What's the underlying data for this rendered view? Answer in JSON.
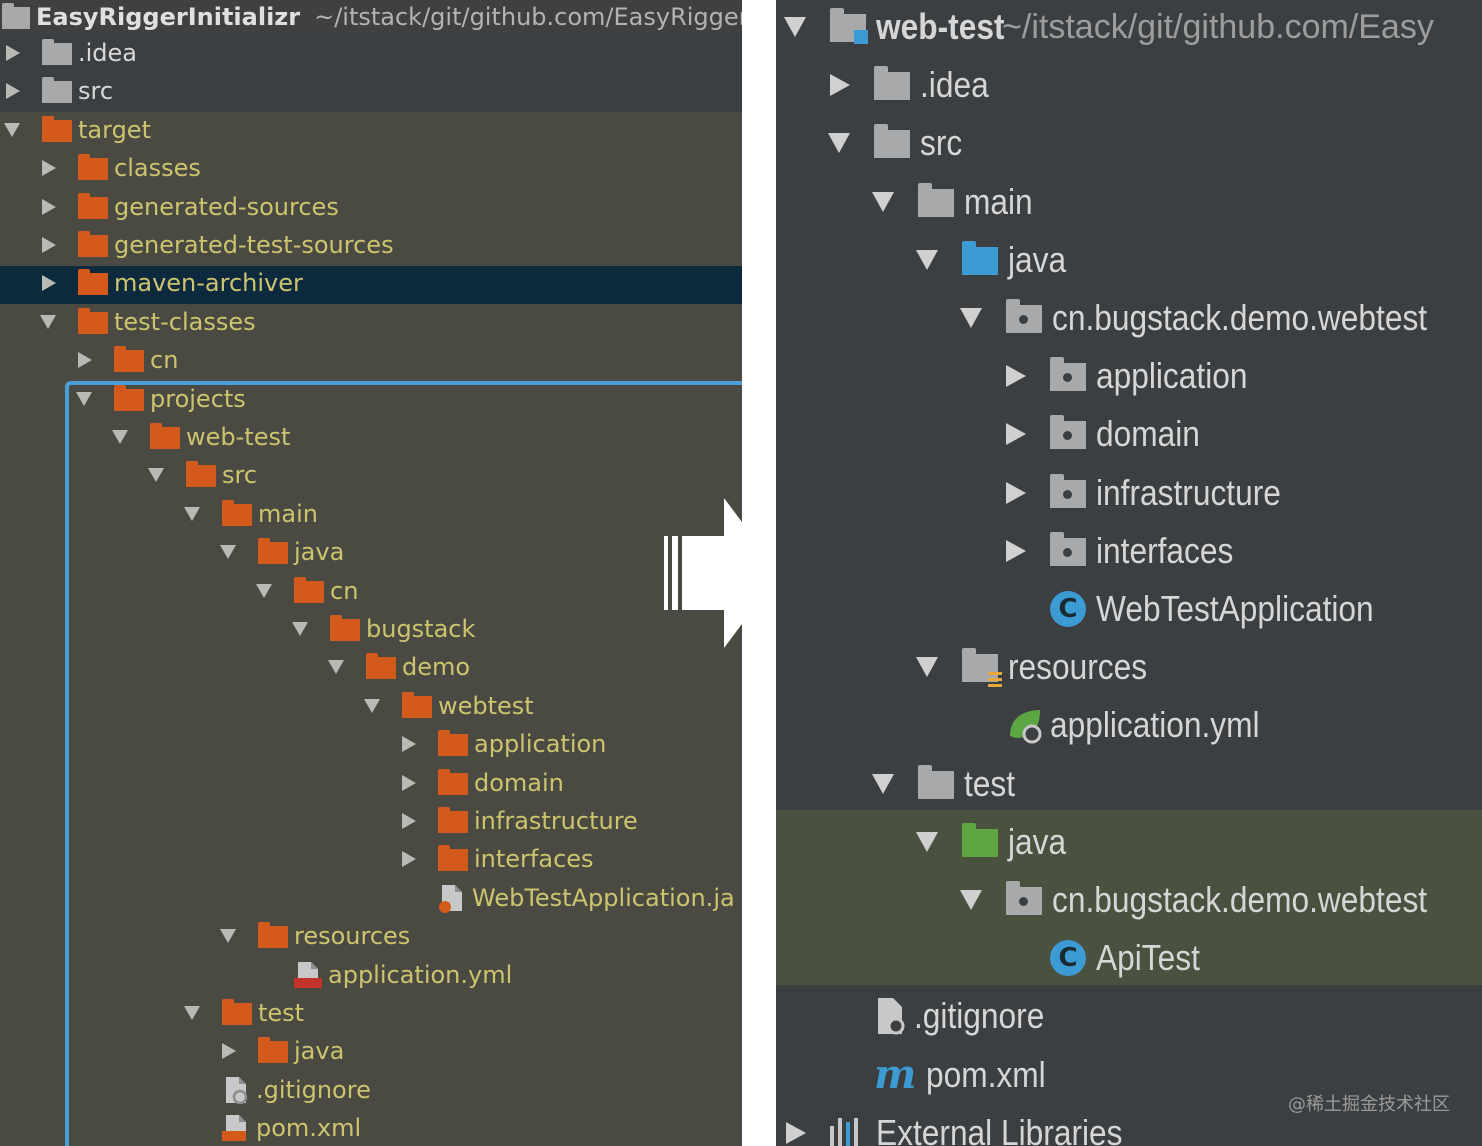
{
  "left_tree": {
    "root": {
      "name": "EasyRiggerInitializr",
      "path": "~/itstack/git/github.com/EasyRigger"
    },
    "items": [
      {
        "label": "EasyRiggerInitializr",
        "state": "root"
      },
      {
        "label": ".idea",
        "state": "collapsed",
        "depth": 0,
        "icon": "grey-folder"
      },
      {
        "label": "src",
        "state": "collapsed",
        "depth": 0,
        "icon": "grey-folder"
      },
      {
        "label": "target",
        "state": "expanded",
        "depth": 0,
        "icon": "orange-folder"
      },
      {
        "label": "classes",
        "state": "collapsed",
        "depth": 1,
        "icon": "orange-folder"
      },
      {
        "label": "generated-sources",
        "state": "collapsed",
        "depth": 1,
        "icon": "orange-folder"
      },
      {
        "label": "generated-test-sources",
        "state": "collapsed",
        "depth": 1,
        "icon": "orange-folder"
      },
      {
        "label": "maven-archiver",
        "state": "collapsed",
        "depth": 1,
        "icon": "orange-folder",
        "selected": true
      },
      {
        "label": "test-classes",
        "state": "expanded",
        "depth": 1,
        "icon": "orange-folder"
      },
      {
        "label": "cn",
        "state": "collapsed",
        "depth": 2,
        "icon": "orange-folder"
      },
      {
        "label": "projects",
        "state": "expanded",
        "depth": 2,
        "icon": "orange-folder"
      },
      {
        "label": "web-test",
        "state": "expanded",
        "depth": 3,
        "icon": "orange-folder"
      },
      {
        "label": "src",
        "state": "expanded",
        "depth": 4,
        "icon": "orange-folder"
      },
      {
        "label": "main",
        "state": "expanded",
        "depth": 5,
        "icon": "orange-folder"
      },
      {
        "label": "java",
        "state": "expanded",
        "depth": 6,
        "icon": "orange-folder"
      },
      {
        "label": "cn",
        "state": "expanded",
        "depth": 7,
        "icon": "orange-folder"
      },
      {
        "label": "bugstack",
        "state": "expanded",
        "depth": 8,
        "icon": "orange-folder"
      },
      {
        "label": "demo",
        "state": "expanded",
        "depth": 9,
        "icon": "orange-folder"
      },
      {
        "label": "webtest",
        "state": "expanded",
        "depth": 10,
        "icon": "orange-folder"
      },
      {
        "label": "application",
        "state": "collapsed",
        "depth": 11,
        "icon": "orange-folder"
      },
      {
        "label": "domain",
        "state": "collapsed",
        "depth": 11,
        "icon": "orange-folder"
      },
      {
        "label": "infrastructure",
        "state": "collapsed",
        "depth": 11,
        "icon": "orange-folder"
      },
      {
        "label": "interfaces",
        "state": "collapsed",
        "depth": 11,
        "icon": "orange-folder"
      },
      {
        "label": "WebTestApplication.ja",
        "state": "leaf",
        "depth": 11,
        "icon": "java-file"
      },
      {
        "label": "resources",
        "state": "expanded",
        "depth": 6,
        "icon": "orange-folder"
      },
      {
        "label": "application.yml",
        "state": "leaf",
        "depth": 7,
        "icon": "yml-file"
      },
      {
        "label": "test",
        "state": "expanded",
        "depth": 5,
        "icon": "orange-folder"
      },
      {
        "label": "java",
        "state": "collapsed",
        "depth": 6,
        "icon": "orange-folder"
      },
      {
        "label": ".gitignore",
        "state": "leaf",
        "depth": 5,
        "icon": "gitignore-file"
      },
      {
        "label": "pom.xml",
        "state": "leaf",
        "depth": 5,
        "icon": "xml-file"
      }
    ]
  },
  "right_tree": {
    "root": {
      "name": "web-test",
      "path": "~/itstack/git/github.com/Easy"
    },
    "items": [
      {
        "label": "web-test",
        "state": "root"
      },
      {
        "label": ".idea",
        "state": "collapsed",
        "depth": 1,
        "icon": "grey-folder"
      },
      {
        "label": "src",
        "state": "expanded",
        "depth": 1,
        "icon": "grey-folder"
      },
      {
        "label": "main",
        "state": "expanded",
        "depth": 2,
        "icon": "grey-folder"
      },
      {
        "label": "java",
        "state": "expanded",
        "depth": 3,
        "icon": "blue-folder"
      },
      {
        "label": "cn.bugstack.demo.webtest",
        "state": "expanded",
        "depth": 4,
        "icon": "package-folder"
      },
      {
        "label": "application",
        "state": "collapsed",
        "depth": 5,
        "icon": "package-folder"
      },
      {
        "label": "domain",
        "state": "collapsed",
        "depth": 5,
        "icon": "package-folder"
      },
      {
        "label": "infrastructure",
        "state": "collapsed",
        "depth": 5,
        "icon": "package-folder"
      },
      {
        "label": "interfaces",
        "state": "collapsed",
        "depth": 5,
        "icon": "package-folder"
      },
      {
        "label": "WebTestApplication",
        "state": "leaf",
        "depth": 5,
        "icon": "spring-class"
      },
      {
        "label": "resources",
        "state": "expanded",
        "depth": 3,
        "icon": "resources-folder"
      },
      {
        "label": "application.yml",
        "state": "leaf",
        "depth": 4,
        "icon": "spring-yml"
      },
      {
        "label": "test",
        "state": "expanded",
        "depth": 2,
        "icon": "grey-folder"
      },
      {
        "label": "java",
        "state": "expanded",
        "depth": 3,
        "icon": "green-folder",
        "highlighted": true
      },
      {
        "label": "cn.bugstack.demo.webtest",
        "state": "expanded",
        "depth": 4,
        "icon": "package-folder",
        "highlighted": true
      },
      {
        "label": "ApiTest",
        "state": "leaf",
        "depth": 5,
        "icon": "test-class",
        "highlighted": true
      },
      {
        "label": ".gitignore",
        "state": "leaf",
        "depth": 1,
        "icon": "gitignore-file"
      },
      {
        "label": "pom.xml",
        "state": "leaf",
        "depth": 1,
        "icon": "maven-file"
      },
      {
        "label": "External Libraries",
        "state": "collapsed",
        "depth": 0,
        "icon": "libraries"
      }
    ]
  },
  "icons": {
    "class_letter": "C",
    "maven_letter": "m"
  },
  "watermark": "@稀土掘金技术社区",
  "colors": {
    "left_bg": "#4b4a42",
    "right_bg": "#3c3f41",
    "selection": "#0d293e",
    "excluded_text": "#ccc46f",
    "excluded_folder": "#d35a1b",
    "highlight_box": "#4a9fd8",
    "test_band": "#49523f",
    "source_folder": "#3d9bd3",
    "test_folder": "#5ca644"
  }
}
